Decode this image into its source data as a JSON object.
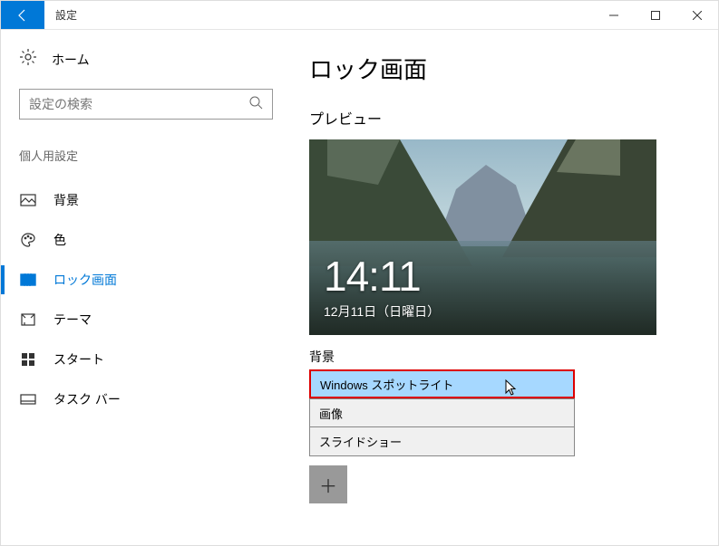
{
  "window": {
    "title": "設定"
  },
  "sidebar": {
    "home": "ホーム",
    "search_placeholder": "設定の検索",
    "section": "個人用設定",
    "items": [
      {
        "label": "背景"
      },
      {
        "label": "色"
      },
      {
        "label": "ロック画面"
      },
      {
        "label": "テーマ"
      },
      {
        "label": "スタート"
      },
      {
        "label": "タスク バー"
      }
    ]
  },
  "main": {
    "title": "ロック画面",
    "preview_label": "プレビュー",
    "time": "14:11",
    "date": "12月11日（日曜日）",
    "bg_label": "背景",
    "dropdown": [
      "Windows スポットライト",
      "画像",
      "スライドショー"
    ],
    "plus": "＋"
  }
}
